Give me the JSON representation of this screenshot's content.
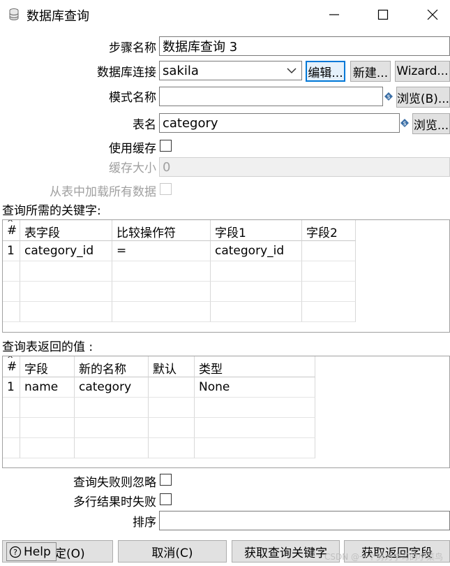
{
  "window": {
    "title": "数据库查询",
    "icon": "database-icon"
  },
  "form": {
    "step_name_label": "步骤名称",
    "step_name_value": "数据库查询 3",
    "connection_label": "数据库连接",
    "connection_value": "sakila",
    "edit_button": "编辑...",
    "new_button": "新建...",
    "wizard_button": "Wizard...",
    "schema_label": "模式名称",
    "schema_value": "",
    "browse_schema_button": "浏览(B)...",
    "table_label": "表名",
    "table_value": "category",
    "browse_table_button": "浏览...",
    "use_cache_label": "使用缓存",
    "use_cache_checked": false,
    "cache_size_label": "缓存大小",
    "cache_size_value": "0",
    "load_all_label": "从表中加载所有数据",
    "load_all_checked": false
  },
  "keys_table": {
    "title": "查询所需的关键字:",
    "columns": [
      "#",
      "表字段",
      "比较操作符",
      "字段1",
      "字段2"
    ],
    "rows": [
      [
        "1",
        "category_id",
        "=",
        "category_id",
        ""
      ]
    ]
  },
  "return_table": {
    "title": "查询表返回的值 :",
    "columns": [
      "#",
      "字段",
      "新的名称",
      "默认",
      "类型"
    ],
    "rows": [
      [
        "1",
        "name",
        "category",
        "",
        "None"
      ]
    ]
  },
  "options": {
    "fail_ignore_label": "查询失败则忽略",
    "fail_ignore_checked": false,
    "multi_fail_label": "多行结果时失败",
    "multi_fail_checked": false,
    "order_label": "排序",
    "order_value": ""
  },
  "buttons": {
    "help": "Help",
    "ok_partial": "定(O)",
    "cancel": "取消(C)",
    "get_keys": "获取查询关键字",
    "get_fields": "获取返回字段"
  },
  "watermark": "CSDN @一个努力学习的小菜鸟"
}
